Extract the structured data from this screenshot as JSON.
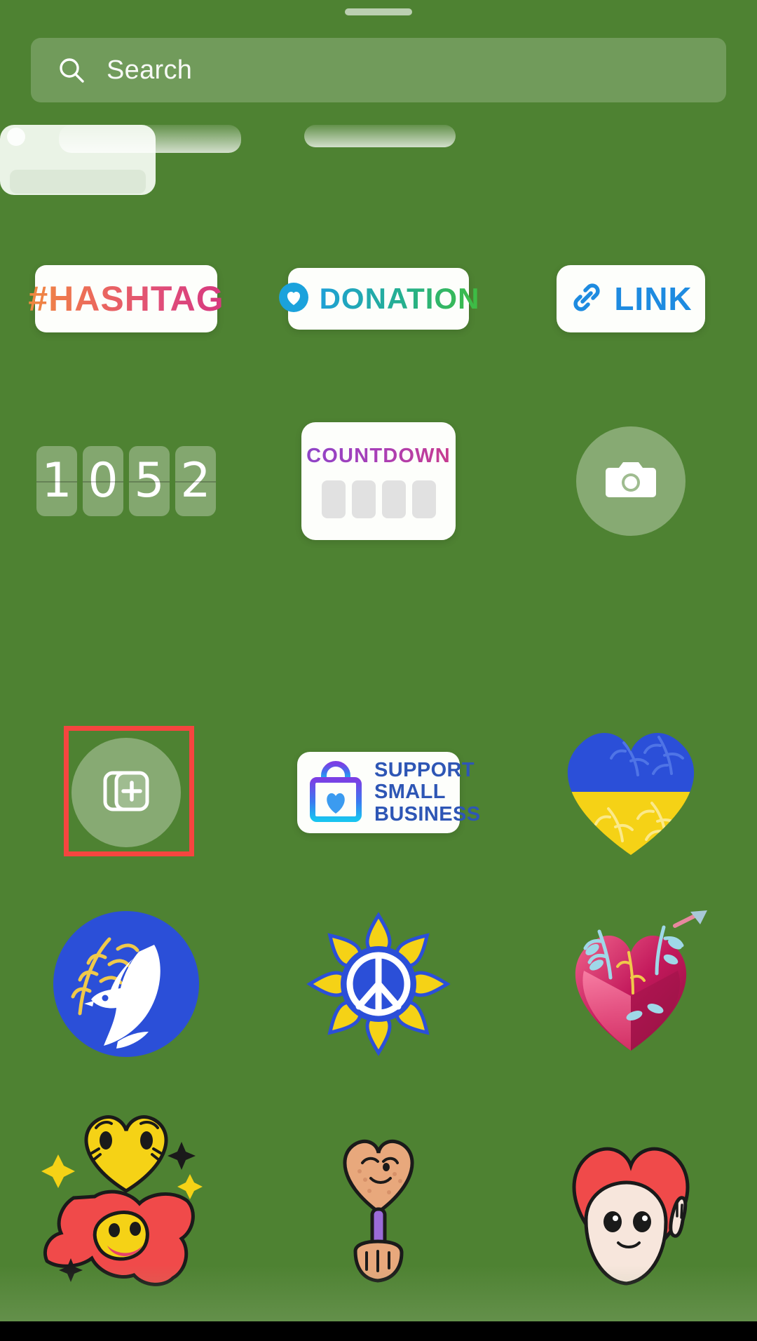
{
  "app": {
    "name": "instagram-stories-sticker-tray",
    "background_color": "#4E8232"
  },
  "search": {
    "placeholder": "Search",
    "value": "",
    "icon": "search-icon"
  },
  "selection": {
    "target": "add-yours-sticker",
    "color": "#F6453F"
  },
  "rows": [
    {
      "name": "interactive-stickers-row",
      "items": [
        {
          "id": "hashtag",
          "label": "#HASHTAG",
          "icon": "hash-icon",
          "gradient_from": "#F08A3E",
          "gradient_to": "#D6387F"
        },
        {
          "id": "donation",
          "label": "DONATION",
          "icon": "heart-circle-icon",
          "gradient_from": "#1EA0D8",
          "gradient_to": "#3FBD3F"
        },
        {
          "id": "link",
          "label": "LINK",
          "icon": "chain-link-icon",
          "color": "#1E8BE0"
        }
      ]
    },
    {
      "name": "time-stickers-row",
      "items": [
        {
          "id": "flipclock",
          "label": "1052",
          "digits": [
            "1",
            "0",
            "5",
            "2"
          ],
          "icon": "flip-clock-icon"
        },
        {
          "id": "countdown",
          "label": "COUNTDOWN",
          "tiles": 4,
          "gradient_from": "#8E44C8",
          "gradient_to": "#C83B8E"
        },
        {
          "id": "camera",
          "label": "",
          "icon": "camera-icon"
        }
      ]
    },
    {
      "name": "community-stickers-row",
      "items": [
        {
          "id": "add-yours",
          "label": "",
          "icon": "add-yours-icon"
        },
        {
          "id": "support-small-business",
          "label": "SUPPORT SMALL BUSINESS",
          "lines": [
            "SUPPORT",
            "SMALL",
            "BUSINESS"
          ],
          "icon": "shopping-bag-heart-icon",
          "text_color": "#2E56B5",
          "gradient_from": "#7B3FE4",
          "gradient_to": "#19C3F0"
        },
        {
          "id": "ukraine-heart",
          "label": "",
          "icon": "ukraine-flag-heart-icon",
          "color_top": "#2B4FD8",
          "color_bottom": "#F5D216"
        }
      ]
    },
    {
      "name": "peace-stickers-row",
      "items": [
        {
          "id": "peace-dove",
          "label": "",
          "icon": "dove-olive-branch-icon",
          "color": "#2B4FD8"
        },
        {
          "id": "peace-sunflower",
          "label": "",
          "icon": "sunflower-peace-sign-icon",
          "color": "#F5D216"
        },
        {
          "id": "floral-heart",
          "label": "",
          "icon": "floral-heart-arrow-icon",
          "color": "#C2185B"
        }
      ]
    },
    {
      "name": "character-stickers-row",
      "items": [
        {
          "id": "sparkle-face",
          "label": "",
          "icon": "sparkle-face-icon",
          "color": "#F5D216"
        },
        {
          "id": "heart-mirror",
          "label": "",
          "icon": "hand-mirror-heart-icon",
          "color": "#E8A87C"
        },
        {
          "id": "heart-character",
          "label": "",
          "icon": "heart-character-icon",
          "color": "#F04A4A"
        }
      ]
    }
  ]
}
